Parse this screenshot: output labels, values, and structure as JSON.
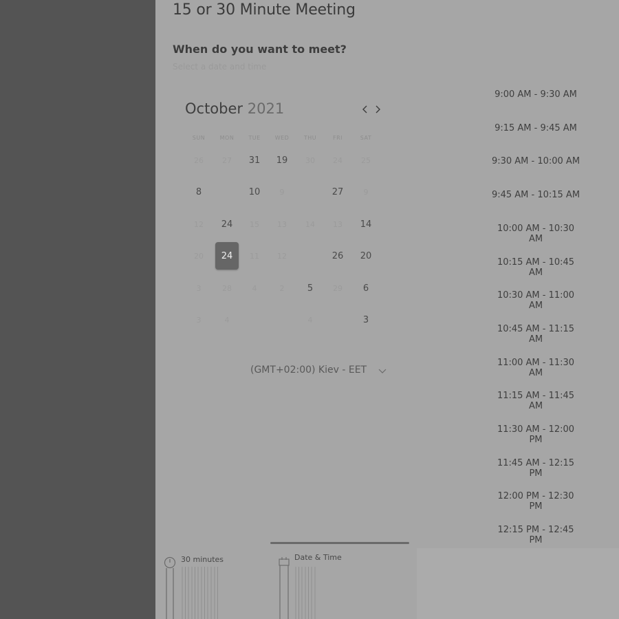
{
  "meeting": {
    "title": "15 or 30 Minute Meeting"
  },
  "prompt": {
    "heading": "When do you want to meet?",
    "hint": "Select a date and time"
  },
  "calendar": {
    "month": "October",
    "year": "2021",
    "weekdays": [
      "SUN",
      "MON",
      "TUE",
      "WED",
      "THU",
      "FRI",
      "SAT"
    ],
    "rows": [
      [
        "26",
        "27",
        "31",
        "19",
        "30",
        "24",
        "25"
      ],
      [
        "8",
        "",
        "10",
        "9",
        "",
        "27",
        "9"
      ],
      [
        "12",
        "24",
        "15",
        "13",
        "14",
        "13",
        "14"
      ],
      [
        "20",
        "24",
        "11",
        "12",
        "",
        "26",
        "20"
      ],
      [
        "3",
        "28",
        "4",
        "2",
        "5",
        "29",
        "6"
      ],
      [
        "3",
        "4",
        "",
        "",
        "4",
        "",
        "3"
      ]
    ],
    "emphasized": [
      [
        false,
        false,
        true,
        true,
        false,
        false,
        false
      ],
      [
        true,
        false,
        true,
        false,
        false,
        true,
        false
      ],
      [
        false,
        true,
        false,
        false,
        false,
        false,
        true
      ],
      [
        false,
        true,
        false,
        false,
        false,
        true,
        true
      ],
      [
        false,
        false,
        false,
        false,
        true,
        false,
        true
      ],
      [
        false,
        false,
        false,
        false,
        false,
        false,
        true
      ]
    ],
    "selected": {
      "row": 3,
      "col": 1
    }
  },
  "timezone": {
    "label": "(GMT+02:00) Kiev - EET"
  },
  "time_slots": [
    "9:00 AM - 9:30 AM",
    "9:15 AM - 9:45 AM",
    "9:30 AM - 10:00 AM",
    "9:45 AM - 10:15 AM",
    "10:00 AM - 10:30 AM",
    "10:15 AM - 10:45 AM",
    "10:30 AM - 11:00 AM",
    "10:45 AM - 11:15 AM",
    "11:00 AM - 11:30 AM",
    "11:15 AM - 11:45 AM",
    "11:30 AM - 12:00 PM",
    "11:45 AM - 12:15 PM",
    "12:00 PM - 12:30 PM",
    "12:15 PM - 12:45 PM"
  ],
  "footer": {
    "duration_label": "30 minutes",
    "datetime_label": "Date & Time"
  },
  "icons": {
    "prev": "chevron-left-icon",
    "next": "chevron-right-icon",
    "timezone": "chevron-down-icon",
    "duration": "clock-icon",
    "datetime": "calendar-icon"
  }
}
